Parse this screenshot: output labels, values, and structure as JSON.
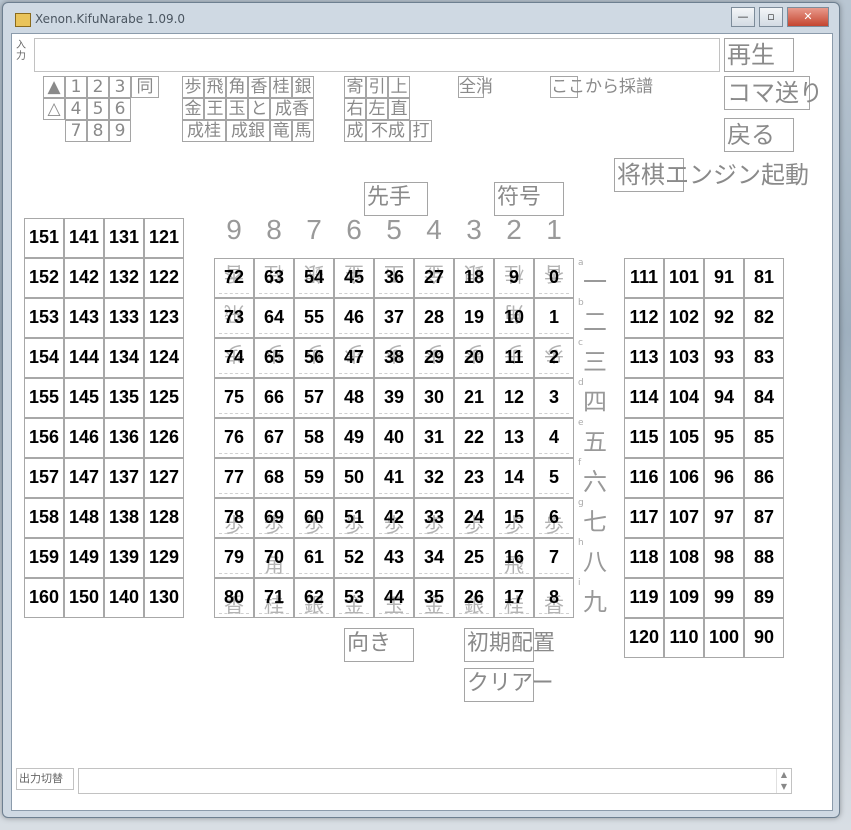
{
  "window": {
    "title": "Xenon.KifuNarabe 1.09.0",
    "minimize": "—",
    "restore": "▫",
    "close": "✕"
  },
  "input": {
    "label": "入力",
    "value": ""
  },
  "output": {
    "label": "出力切替",
    "value": ""
  },
  "buttons": {
    "play": "再生",
    "step": "コマ送り",
    "back": "戻る",
    "engine": "将棋エンジン起動",
    "sente": "先手",
    "notation": "符号",
    "direction": "向き",
    "initial": "初期配置",
    "clear": "クリアー"
  },
  "toolbar": {
    "senteMark": "▲",
    "goteMark": "△",
    "nums": [
      "1",
      "2",
      "3",
      "同",
      "4",
      "5",
      "6",
      "7",
      "8",
      "9"
    ],
    "pieces": [
      "歩",
      "飛",
      "角",
      "香",
      "桂",
      "銀",
      "金",
      "王",
      "玉",
      "と",
      "成香",
      "成桂",
      "成銀",
      "竜",
      "馬"
    ],
    "moves": [
      "寄",
      "引",
      "上",
      "右",
      "左",
      "直",
      "成",
      "不成",
      "打"
    ],
    "clearAll": "全消",
    "recordFromHere": "ここから採譜"
  },
  "board": {
    "columns": [
      "9",
      "8",
      "7",
      "6",
      "5",
      "4",
      "3",
      "2",
      "1"
    ],
    "rowKanji": [
      "一",
      "二",
      "三",
      "四",
      "五",
      "六",
      "七",
      "八",
      "九"
    ],
    "rowLetters": [
      "a",
      "b",
      "c",
      "d",
      "e",
      "f",
      "g",
      "h",
      "i"
    ],
    "goteRow1": [
      "香",
      "桂",
      "銀",
      "金",
      "玉",
      "金",
      "銀",
      "桂",
      "香"
    ],
    "goteRow2": [
      "飛",
      "",
      "",
      "",
      "",
      "",
      "",
      "角",
      ""
    ],
    "goteRow3": [
      "歩",
      "歩",
      "歩",
      "歩",
      "歩",
      "歩",
      "歩",
      "歩",
      "歩"
    ],
    "senteRow7": [
      "歩",
      "歩",
      "歩",
      "歩",
      "歩",
      "歩",
      "歩",
      "歩",
      "歩"
    ],
    "senteRow8": [
      "",
      "角",
      "",
      "",
      "",
      "",
      "",
      "飛",
      ""
    ],
    "senteRow9": [
      "香",
      "桂",
      "銀",
      "金",
      "玉",
      "金",
      "銀",
      "桂",
      "香"
    ]
  },
  "goteHand": {
    "rows": [
      [
        "151",
        "141",
        "131",
        "121"
      ],
      [
        "152",
        "142",
        "132",
        "122"
      ],
      [
        "153",
        "143",
        "133",
        "123"
      ],
      [
        "154",
        "144",
        "134",
        "124"
      ],
      [
        "155",
        "145",
        "135",
        "125"
      ],
      [
        "156",
        "146",
        "136",
        "126"
      ],
      [
        "157",
        "147",
        "137",
        "127"
      ],
      [
        "158",
        "148",
        "138",
        "128"
      ],
      [
        "159",
        "149",
        "139",
        "129"
      ],
      [
        "160",
        "150",
        "140",
        "130"
      ]
    ]
  },
  "senteHand": {
    "rows": [
      [
        "111",
        "101",
        "91",
        "81"
      ],
      [
        "112",
        "102",
        "92",
        "82"
      ],
      [
        "113",
        "103",
        "93",
        "83"
      ],
      [
        "114",
        "104",
        "94",
        "84"
      ],
      [
        "115",
        "105",
        "95",
        "85"
      ],
      [
        "116",
        "106",
        "96",
        "86"
      ],
      [
        "117",
        "107",
        "97",
        "87"
      ],
      [
        "118",
        "108",
        "98",
        "88"
      ],
      [
        "119",
        "109",
        "99",
        "89"
      ],
      [
        "120",
        "110",
        "100",
        "90"
      ]
    ]
  }
}
